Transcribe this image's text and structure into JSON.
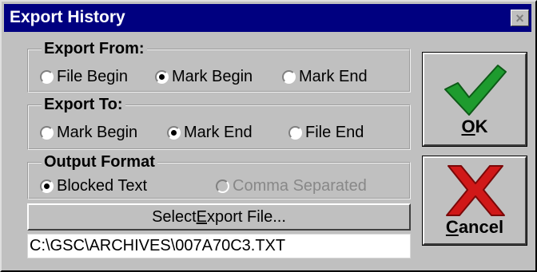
{
  "window": {
    "title": "Export History",
    "close_symbol": "×"
  },
  "export_from": {
    "legend": "Export From:",
    "options": [
      "File Begin",
      "Mark Begin",
      "Mark End"
    ],
    "selected_index": 1
  },
  "export_to": {
    "legend": "Export To:",
    "options": [
      "Mark Begin",
      "Mark End",
      "File End"
    ],
    "selected_index": 1
  },
  "output_format": {
    "legend": "Output Format",
    "options": [
      "Blocked Text",
      "Comma Separated"
    ],
    "selected_index": 0,
    "disabled_index": 1
  },
  "select_button": {
    "label_before": "Select ",
    "mnemonic": "E",
    "label_after": "xport File..."
  },
  "file_path": "C:\\GSC\\ARCHIVES\\007A70C3.TXT",
  "ok_button": {
    "mnemonic": "O",
    "rest": "K",
    "icon": "green-checkmark"
  },
  "cancel_button": {
    "mnemonic": "C",
    "rest": "ancel",
    "icon": "red-x"
  },
  "colors": {
    "title_bar": "#000080",
    "face": "#c0c0c0",
    "check": "#1e9b2e",
    "x_mark": "#d01818"
  }
}
